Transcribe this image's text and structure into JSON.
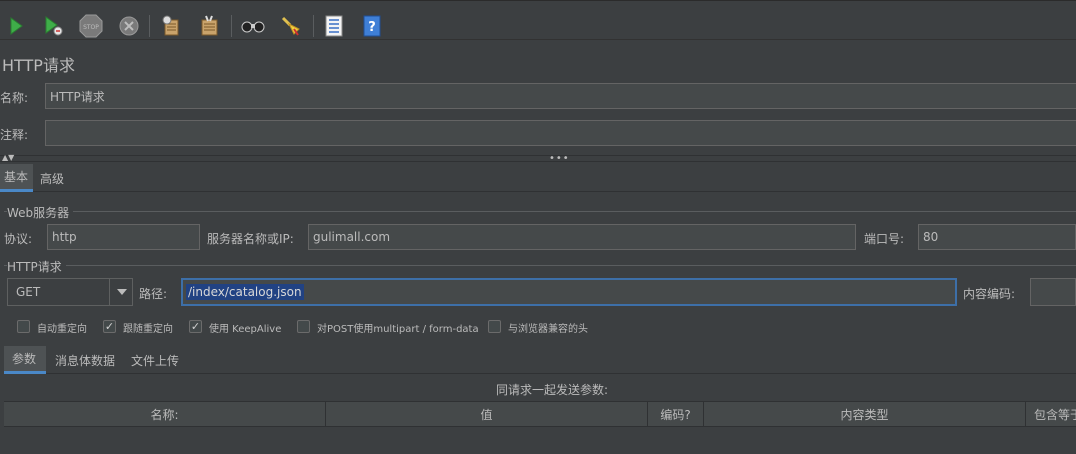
{
  "toolbar": {
    "buttons": [
      {
        "name": "start-icon",
        "color": "#4caf50"
      },
      {
        "name": "start-no-pauses-icon",
        "color": "#4caf50"
      },
      {
        "name": "stop-icon",
        "label": "STOP",
        "color": "#8a8a8a"
      },
      {
        "name": "shutdown-icon",
        "color": "#8a8a8a"
      },
      {
        "name": "clear-icon"
      },
      {
        "name": "clear-all-icon"
      },
      {
        "name": "search-icon"
      },
      {
        "name": "reset-search-icon"
      },
      {
        "name": "function-helper-icon"
      },
      {
        "name": "help-icon",
        "label": "?"
      }
    ]
  },
  "panel": {
    "title": "HTTP请求",
    "name_label": "名称:",
    "name_value": "HTTP请求",
    "comment_label": "注释:",
    "comment_value": "",
    "splitter_dots": "•••"
  },
  "tabs": [
    {
      "label": "基本",
      "active": true
    },
    {
      "label": "高级",
      "active": false
    }
  ],
  "web_server": {
    "group_title": "Web服务器",
    "protocol_label": "协议:",
    "protocol_value": "http",
    "server_label": "服务器名称或IP:",
    "server_value": "gulimall.com",
    "port_label": "端口号:",
    "port_value": "80"
  },
  "http_request": {
    "group_title": "HTTP请求",
    "method_value": "GET",
    "path_label": "路径:",
    "path_value": "/index/catalog.json",
    "encoding_label": "内容编码:",
    "encoding_value": ""
  },
  "checkboxes": [
    {
      "label": "自动重定向",
      "checked": false
    },
    {
      "label": "跟随重定向",
      "checked": true
    },
    {
      "label": "使用 KeepAlive",
      "checked": true
    },
    {
      "label": "对POST使用multipart / form-data",
      "checked": false
    },
    {
      "label": "与浏览器兼容的头",
      "checked": false
    }
  ],
  "subtabs": [
    {
      "label": "参数",
      "active": true
    },
    {
      "label": "消息体数据",
      "active": false
    },
    {
      "label": "文件上传",
      "active": false
    }
  ],
  "params": {
    "caption": "同请求一起发送参数:",
    "columns": [
      "名称:",
      "值",
      "编码?",
      "内容类型",
      "包含等于?"
    ]
  },
  "colors": {
    "background": "#3c3f41",
    "field_bg": "#45494a",
    "accent": "#4a88c7",
    "selection": "#214283"
  }
}
